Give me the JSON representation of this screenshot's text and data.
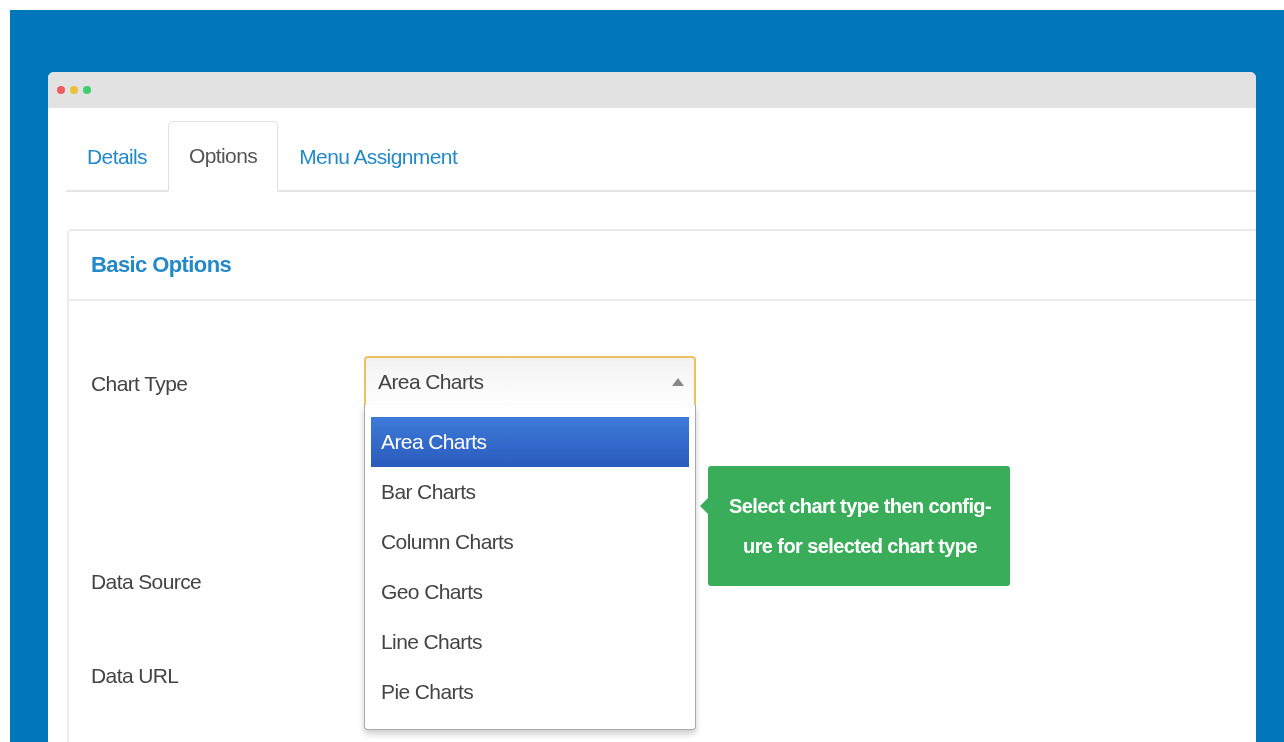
{
  "tabs": [
    {
      "label": "Details",
      "selected": false
    },
    {
      "label": "Options",
      "selected": true
    },
    {
      "label": "Menu Assignment",
      "selected": false
    }
  ],
  "panel": {
    "title": "Basic Options",
    "fields": [
      {
        "label": "Chart Type",
        "kind": "select",
        "value": "Area Charts",
        "expanded": true,
        "options": [
          {
            "label": "Area Charts",
            "selected": true
          },
          {
            "label": "Bar Charts",
            "selected": false
          },
          {
            "label": "Column Charts",
            "selected": false
          },
          {
            "label": "Geo Charts",
            "selected": false
          },
          {
            "label": "Line Charts",
            "selected": false
          },
          {
            "label": "Pie Charts",
            "selected": false
          }
        ],
        "tooltip": "Select chart type then config-ure for selected chart type"
      },
      {
        "label": "Data Source",
        "kind": "hidden"
      },
      {
        "label": "Data URL",
        "kind": "hidden"
      }
    ]
  }
}
